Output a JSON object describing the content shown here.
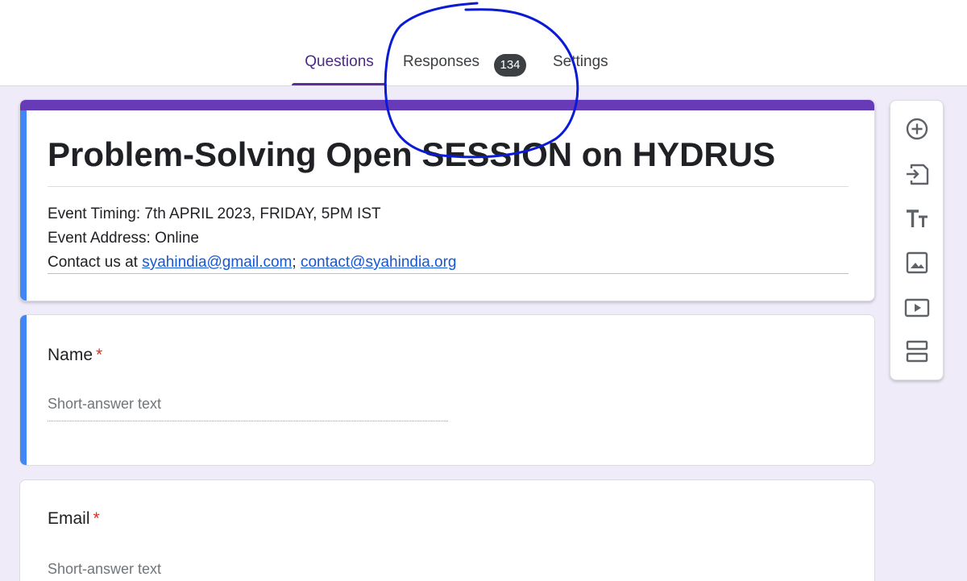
{
  "tabs": {
    "questions": "Questions",
    "responses": "Responses",
    "responses_count": "134",
    "settings": "Settings"
  },
  "form": {
    "title": "Problem-Solving Open SESSION on HYDRUS",
    "timing": "Event Timing: 7th APRIL 2023, FRIDAY, 5PM IST",
    "address": "Event Address: Online",
    "contact_prefix": "Contact us at ",
    "email_1": "syahindia@gmail.com",
    "separator": ";",
    "email_2": "contact@syahindia.org"
  },
  "questions": [
    {
      "title": "Name",
      "required_mark": "*",
      "placeholder": "Short-answer text"
    },
    {
      "title": "Email",
      "required_mark": "*",
      "placeholder": "Short-answer text"
    }
  ],
  "toolbar": {
    "icons": [
      "add-question-icon",
      "import-questions-icon",
      "add-title-icon",
      "add-image-icon",
      "add-video-icon",
      "add-section-icon"
    ]
  },
  "colors": {
    "theme": "#673ab7",
    "active_accent": "#4285f4",
    "background": "#efebf8",
    "annotation": "#0a1ad6"
  }
}
